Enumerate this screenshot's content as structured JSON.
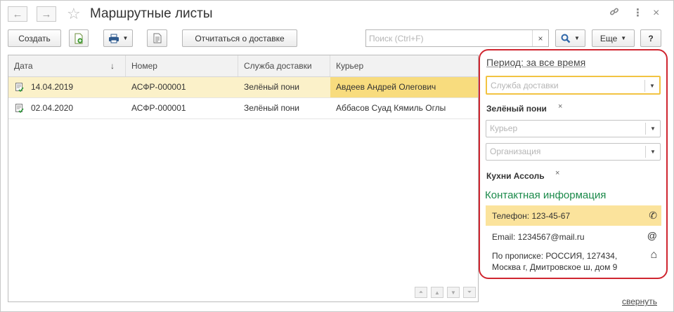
{
  "window": {
    "title": "Маршрутные листы",
    "nav_back_icon": "arrow-left-icon",
    "nav_forward_icon": "arrow-right-icon"
  },
  "toolbar": {
    "create_label": "Создать",
    "report_delivery_label": "Отчитаться о доставке",
    "search_placeholder": "Поиск (Ctrl+F)",
    "search_clear": "×",
    "more_label": "Еще",
    "help_label": "?"
  },
  "table": {
    "columns": [
      "Дата",
      "Номер",
      "Служба доставки",
      "Курьер"
    ],
    "sort_indicator": "↓",
    "rows": [
      {
        "date": "14.04.2019",
        "number": "АСФР-000001",
        "service": "Зелёный пони",
        "courier": "Авдеев Андрей Олегович"
      },
      {
        "date": "02.04.2020",
        "number": "АСФР-000001",
        "service": "Зелёный пони",
        "courier": "Аббасов Суад Кямиль Оглы"
      }
    ]
  },
  "filter": {
    "period_link": "Период: за все время",
    "service_placeholder": "Служба доставки",
    "service_value": "Зелёный пони",
    "courier_placeholder": "Курьер",
    "organization_placeholder": "Организация",
    "organization_value": "Кухни Ассоль",
    "remove_mark": "×",
    "contact_header": "Контактная информация",
    "contacts": [
      {
        "text": "Телефон: 123-45-67",
        "icon": "phone-icon",
        "glyph": "✆"
      },
      {
        "text": "Email: 1234567@mail.ru",
        "icon": "at-icon",
        "glyph": "@"
      },
      {
        "text": "По прописке: РОССИЯ, 127434, Москва г, Дмитровское ш, дом 9",
        "icon": "home-icon",
        "glyph": "⌂"
      }
    ]
  },
  "footer": {
    "collapse_link": "свернуть"
  },
  "colors": {
    "accent_red": "#d02630",
    "selection_row": "#fbf1c9",
    "selection_cell": "#f8dc7e",
    "contact_green": "#1b8a4a"
  }
}
